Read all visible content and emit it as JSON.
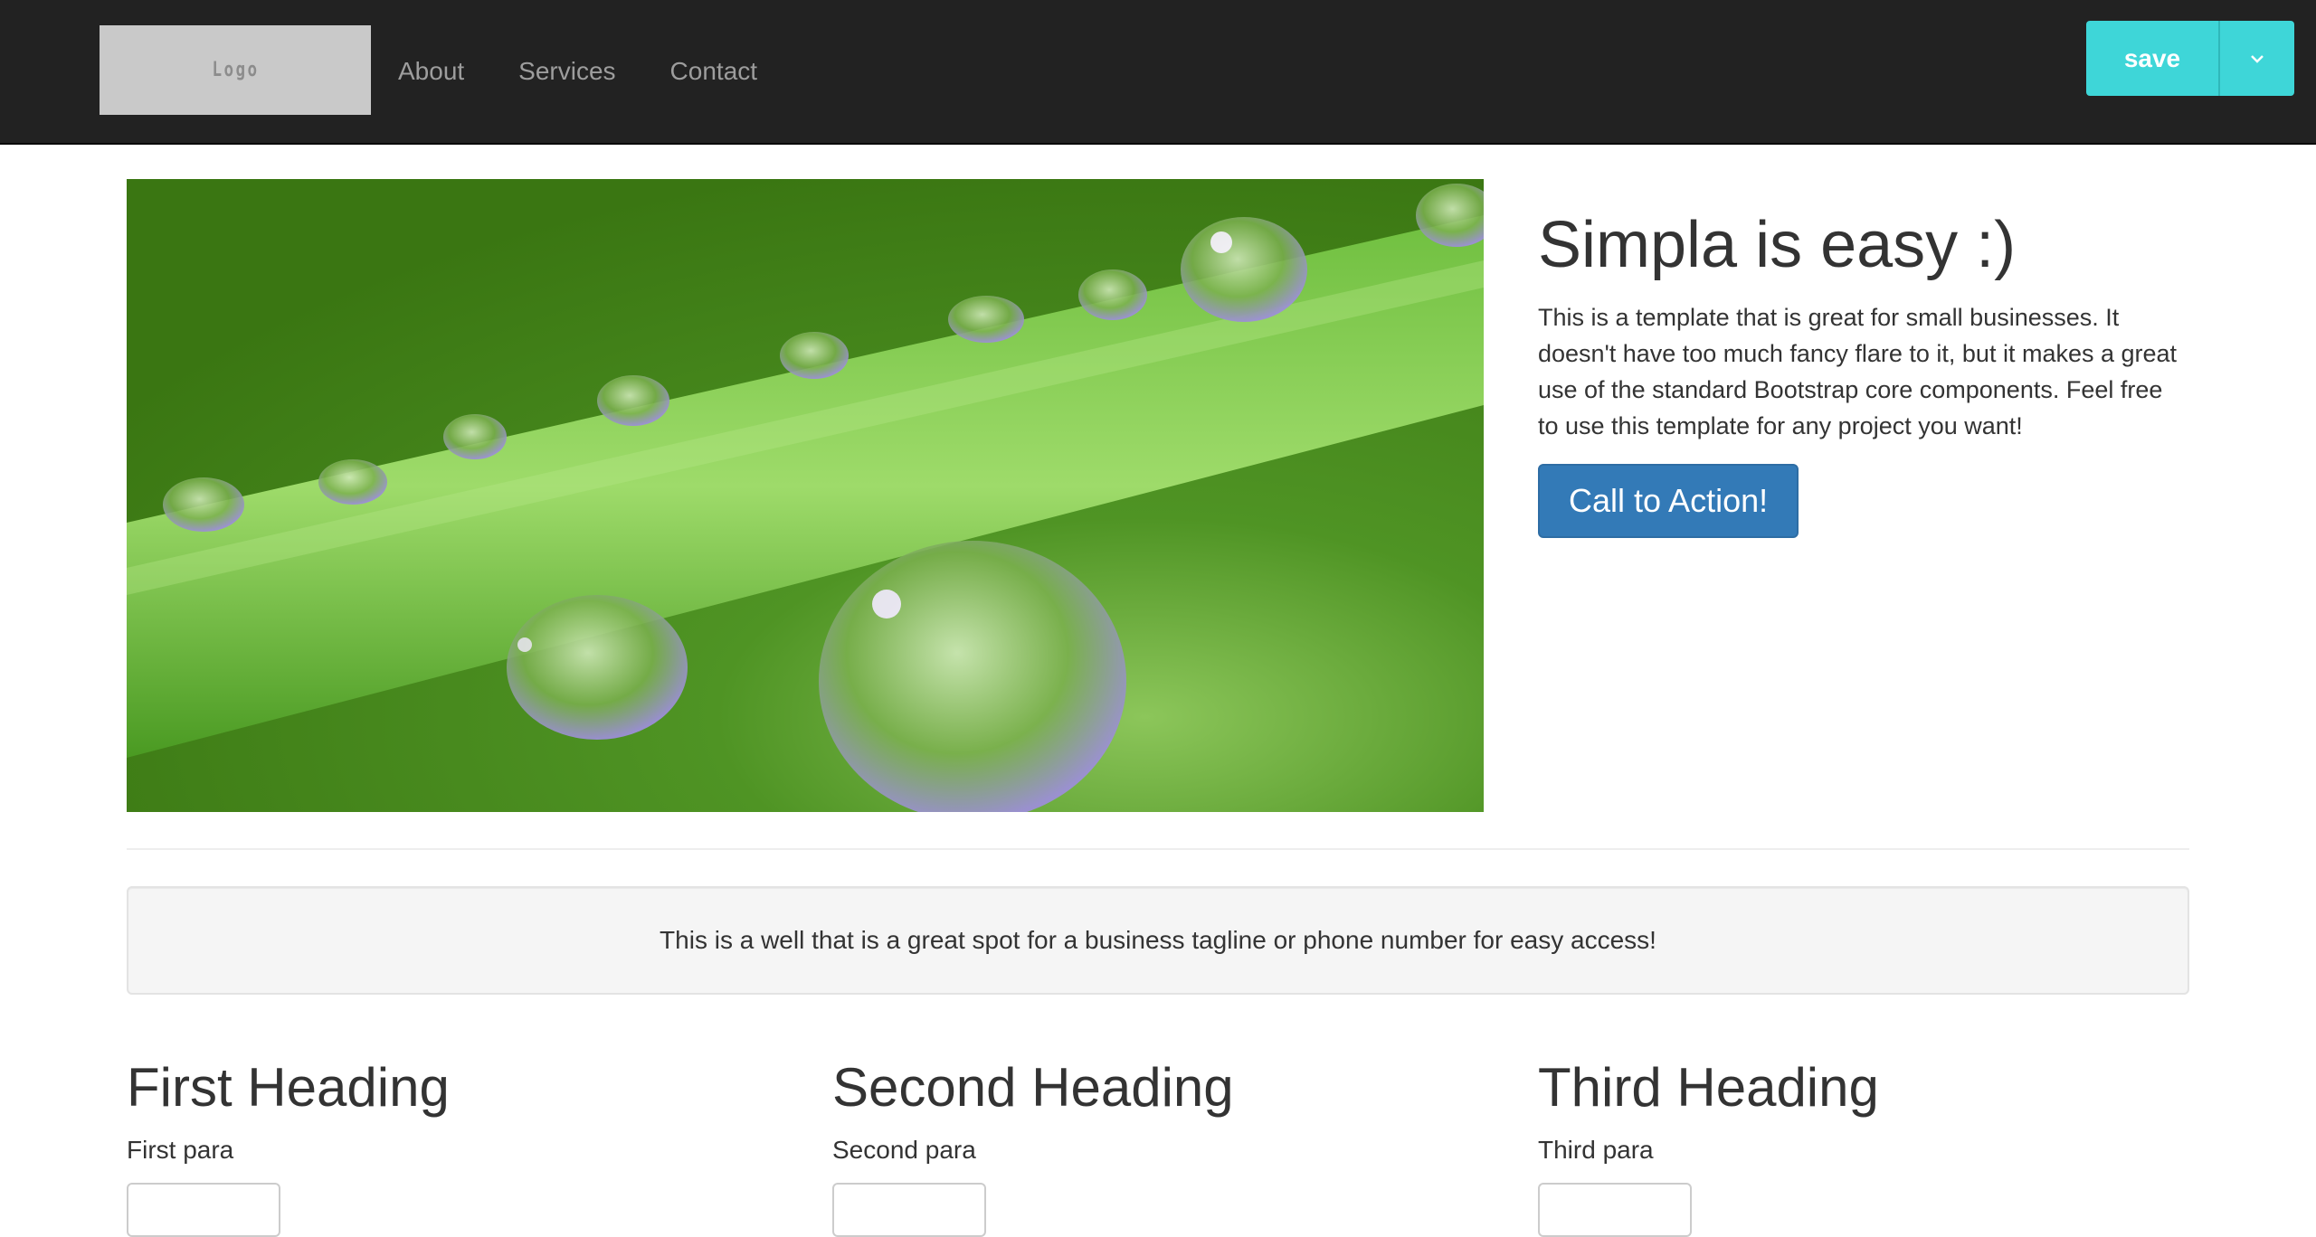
{
  "navbar": {
    "logo_text": "Logo",
    "links": [
      "About",
      "Services",
      "Contact"
    ],
    "save_label": "save",
    "accent_color": "#3ed6d8",
    "background_color": "#222222"
  },
  "hero": {
    "image_icon": "water-droplets-on-grass-photo",
    "title": "Simpla is easy :)",
    "paragraph": "This is a template that is great for small businesses. It doesn't have too much fancy flare to it, but it makes a great use of the standard Bootstrap core components. Feel free to use this template for any project you want!",
    "cta_label": "Call to Action!",
    "cta_color": "#337ab7"
  },
  "well": {
    "text": "This is a well that is a great spot for a business tagline or phone number for easy access!"
  },
  "columns": [
    {
      "heading": "First Heading",
      "para": "First para"
    },
    {
      "heading": "Second Heading",
      "para": "Second para"
    },
    {
      "heading": "Third Heading",
      "para": "Third para"
    }
  ]
}
